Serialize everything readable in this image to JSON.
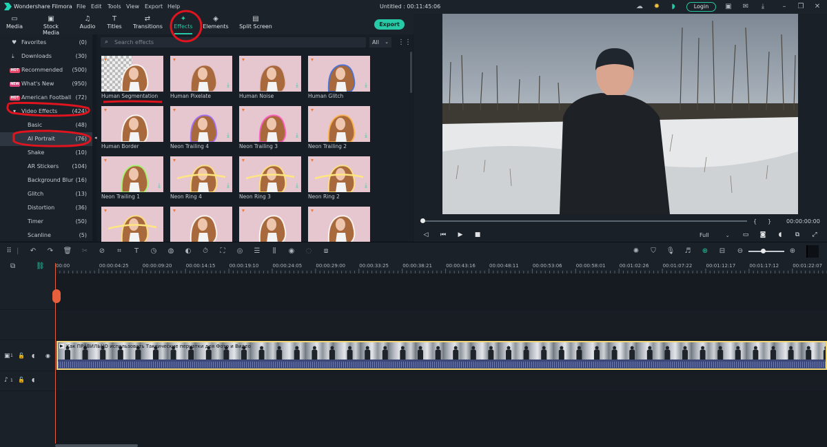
{
  "app": {
    "name": "Wondershare Filmora",
    "project_title": "Untitled : 00:11:45:06",
    "login_label": "Login"
  },
  "menu": [
    "File",
    "Edit",
    "Tools",
    "View",
    "Export",
    "Help"
  ],
  "tabs": [
    {
      "label": "Media",
      "icon": "folder-icon"
    },
    {
      "label": "Stock Media",
      "icon": "stock-icon"
    },
    {
      "label": "Audio",
      "icon": "music-icon"
    },
    {
      "label": "Titles",
      "icon": "text-icon"
    },
    {
      "label": "Transitions",
      "icon": "transition-icon"
    },
    {
      "label": "Effects",
      "icon": "effects-icon",
      "active": true
    },
    {
      "label": "Elements",
      "icon": "elements-icon"
    },
    {
      "label": "Split Screen",
      "icon": "split-screen-icon"
    }
  ],
  "export_label": "Export",
  "sidebar": {
    "items": [
      {
        "label": "Favorites",
        "count": "(0)",
        "icon": "heart-icon"
      },
      {
        "label": "Downloads",
        "count": "(30)",
        "icon": "download-icon"
      },
      {
        "label": "Recommended",
        "count": "(500)",
        "badge": "HOT"
      },
      {
        "label": "What's New",
        "count": "(950)",
        "badge": "NEW"
      },
      {
        "label": "American Football",
        "count": "(72)",
        "badge": "HOT"
      },
      {
        "label": "Video Effects",
        "count": "(424)",
        "icon": "caret-down-icon"
      },
      {
        "label": "Basic",
        "count": "(48)"
      },
      {
        "label": "AI Portrait",
        "count": "(76)",
        "selected": true
      },
      {
        "label": "Shake",
        "count": "(10)"
      },
      {
        "label": "AR Stickers",
        "count": "(104)"
      },
      {
        "label": "Background Blur",
        "count": "(16)"
      },
      {
        "label": "Glitch",
        "count": "(13)"
      },
      {
        "label": "Distortion",
        "count": "(36)"
      },
      {
        "label": "Timer",
        "count": "(50)"
      },
      {
        "label": "Scanline",
        "count": "(5)"
      }
    ]
  },
  "effects": {
    "search_placeholder": "Search effects",
    "filter_value": "All",
    "items": [
      {
        "label": "Human Segmentation",
        "tint": "#ffffff"
      },
      {
        "label": "Human Pixelate",
        "tint": "#e9c8d0"
      },
      {
        "label": "Human Noise",
        "tint": "#e6c4ce"
      },
      {
        "label": "Human Glitch",
        "tint": "#3a6fe0"
      },
      {
        "label": "Human Border",
        "tint": "#ffffff"
      },
      {
        "label": "Neon Trailing 4",
        "tint": "#9b6cff"
      },
      {
        "label": "Neon Trailing 3",
        "tint": "#ff5ac8"
      },
      {
        "label": "Neon Trailing 2",
        "tint": "#ffb54a"
      },
      {
        "label": "Neon Trailing 1",
        "tint": "#9cff6a"
      },
      {
        "label": "Neon Ring 4",
        "tint": "#ffe680"
      },
      {
        "label": "Neon Ring 3",
        "tint": "#ffe680"
      },
      {
        "label": "Neon Ring 2",
        "tint": "#ffe680"
      },
      {
        "label": "",
        "tint": "#ffe680"
      },
      {
        "label": "",
        "tint": "#ffffff"
      },
      {
        "label": "",
        "tint": "#ffffff"
      },
      {
        "label": "",
        "tint": "#ffffff"
      }
    ]
  },
  "preview": {
    "timecode": "00:00:00:00",
    "zoom": "Full"
  },
  "ruler": [
    "00:00",
    "00:00:04:25",
    "00:00:09:20",
    "00:00:14:15",
    "00:00:19:10",
    "00:00:24:05",
    "00:00:29:00",
    "00:00:33:25",
    "00:00:38:21",
    "00:00:43:16",
    "00:00:48:11",
    "00:00:53:06",
    "00:00:58:01",
    "00:01:02:26",
    "00:01:07:22",
    "00:01:12:17",
    "00:01:17:12",
    "00:01:22:07"
  ],
  "tracks": {
    "video_label": "1",
    "audio_label": "1",
    "clip_title": "Как ПРАВИЛЬНО использовать Тактические перчатки для Фото и Видео"
  },
  "colors": {
    "accent": "#27c9a6",
    "annotation": "#e0141e",
    "playhead": "#e8603b"
  }
}
